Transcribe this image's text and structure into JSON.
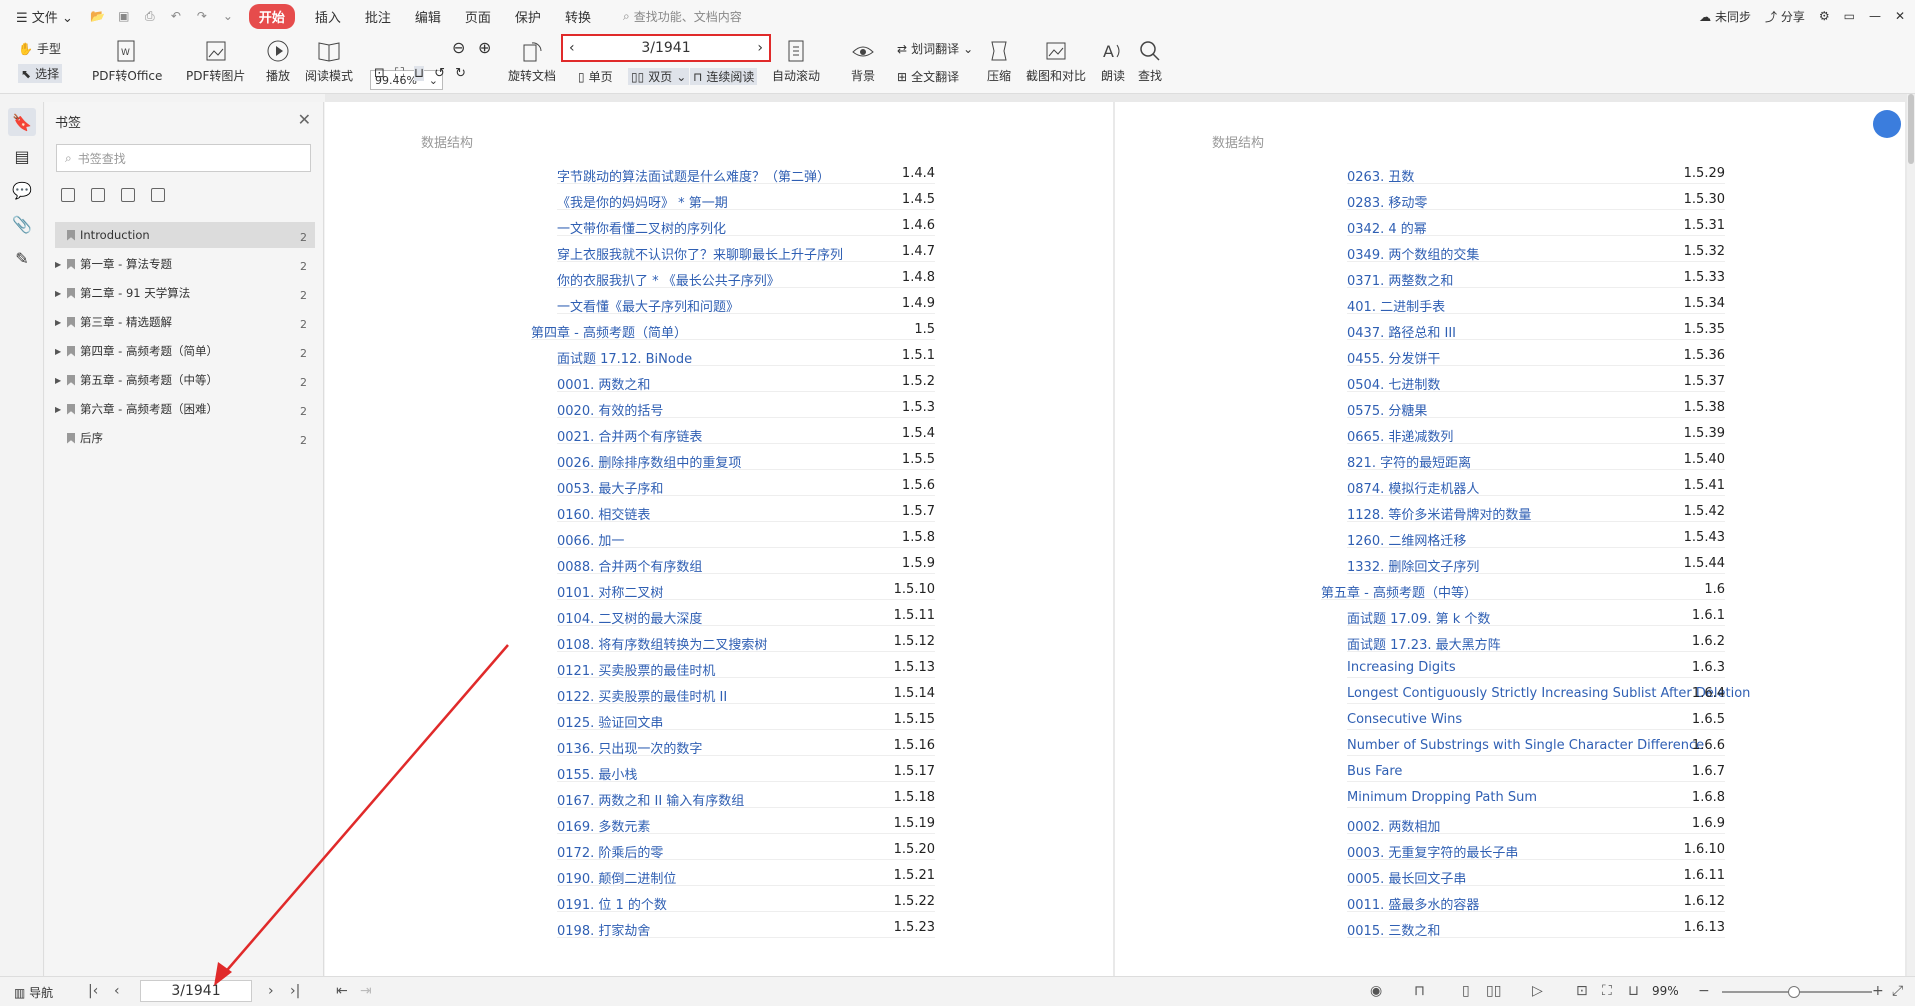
{
  "menubar": {
    "file": "文件",
    "tabs": [
      "开始",
      "插入",
      "批注",
      "编辑",
      "页面",
      "保护",
      "转换"
    ],
    "active_tab": "开始",
    "search_placeholder": "查找功能、文档内容",
    "sync": "未同步",
    "share": "分享"
  },
  "toolbar": {
    "hand": "手型",
    "select": "选择",
    "pdf_to_office": "PDF转Office",
    "pdf_to_image": "PDF转图片",
    "play": "播放",
    "read_mode": "阅读模式",
    "zoom": "99.46%",
    "rotate": "旋转文档",
    "single": "单页",
    "double": "双页",
    "continuous": "连续阅读",
    "page_indicator": "3/1941",
    "auto_scroll": "自动滚动",
    "background": "背景",
    "word_translate": "划词翻译",
    "full_translate": "全文翻译",
    "compress": "压缩",
    "screenshot": "截图和对比",
    "read_aloud": "朗读",
    "find": "查找"
  },
  "panel": {
    "title": "书签",
    "search_placeholder": "书签查找",
    "items": [
      {
        "label": "Introduction",
        "count": "2",
        "expandable": false
      },
      {
        "label": "第一章 - 算法专题",
        "count": "2",
        "expandable": true
      },
      {
        "label": "第二章 - 91 天学算法",
        "count": "2",
        "expandable": true
      },
      {
        "label": "第三章 - 精选题解",
        "count": "2",
        "expandable": true
      },
      {
        "label": "第四章 - 高频考题（简单）",
        "count": "2",
        "expandable": true
      },
      {
        "label": "第五章 - 高频考题（中等）",
        "count": "2",
        "expandable": true
      },
      {
        "label": "第六章 - 高频考题（困难）",
        "count": "2",
        "expandable": true
      },
      {
        "label": "后序",
        "count": "2",
        "expandable": false
      }
    ]
  },
  "left_page": {
    "header": "数据结构",
    "rows": [
      {
        "t": "字节跳动的算法面试题是什么难度？（第二弹）",
        "n": "1.4.4",
        "lvl": 2
      },
      {
        "t": "《我是你的妈妈呀》 * 第一期",
        "n": "1.4.5",
        "lvl": 2
      },
      {
        "t": "一文带你看懂二叉树的序列化",
        "n": "1.4.6",
        "lvl": 2
      },
      {
        "t": "穿上衣服我就不认识你了？来聊聊最长上升子序列",
        "n": "1.4.7",
        "lvl": 2
      },
      {
        "t": "你的衣服我扒了 * 《最长公共子序列》",
        "n": "1.4.8",
        "lvl": 2
      },
      {
        "t": "一文看懂《最大子序列和问题》",
        "n": "1.4.9",
        "lvl": 2
      },
      {
        "t": "第四章 - 高频考题（简单）",
        "n": "1.5",
        "lvl": 1
      },
      {
        "t": "面试题 17.12. BiNode",
        "n": "1.5.1",
        "lvl": 2
      },
      {
        "t": "0001. 两数之和",
        "n": "1.5.2",
        "lvl": 2
      },
      {
        "t": "0020. 有效的括号",
        "n": "1.5.3",
        "lvl": 2
      },
      {
        "t": "0021. 合并两个有序链表",
        "n": "1.5.4",
        "lvl": 2
      },
      {
        "t": "0026. 删除排序数组中的重复项",
        "n": "1.5.5",
        "lvl": 2
      },
      {
        "t": "0053. 最大子序和",
        "n": "1.5.6",
        "lvl": 2
      },
      {
        "t": "0160. 相交链表",
        "n": "1.5.7",
        "lvl": 2
      },
      {
        "t": "0066. 加一",
        "n": "1.5.8",
        "lvl": 2
      },
      {
        "t": "0088. 合并两个有序数组",
        "n": "1.5.9",
        "lvl": 2
      },
      {
        "t": "0101. 对称二叉树",
        "n": "1.5.10",
        "lvl": 2
      },
      {
        "t": "0104. 二叉树的最大深度",
        "n": "1.5.11",
        "lvl": 2
      },
      {
        "t": "0108. 将有序数组转换为二叉搜索树",
        "n": "1.5.12",
        "lvl": 2
      },
      {
        "t": "0121. 买卖股票的最佳时机",
        "n": "1.5.13",
        "lvl": 2
      },
      {
        "t": "0122. 买卖股票的最佳时机 II",
        "n": "1.5.14",
        "lvl": 2
      },
      {
        "t": "0125. 验证回文串",
        "n": "1.5.15",
        "lvl": 2
      },
      {
        "t": "0136. 只出现一次的数字",
        "n": "1.5.16",
        "lvl": 2
      },
      {
        "t": "0155. 最小栈",
        "n": "1.5.17",
        "lvl": 2
      },
      {
        "t": "0167. 两数之和 II 输入有序数组",
        "n": "1.5.18",
        "lvl": 2
      },
      {
        "t": "0169. 多数元素",
        "n": "1.5.19",
        "lvl": 2
      },
      {
        "t": "0172. 阶乘后的零",
        "n": "1.5.20",
        "lvl": 2
      },
      {
        "t": "0190. 颠倒二进制位",
        "n": "1.5.21",
        "lvl": 2
      },
      {
        "t": "0191. 位 1 的个数",
        "n": "1.5.22",
        "lvl": 2
      },
      {
        "t": "0198. 打家劫舍",
        "n": "1.5.23",
        "lvl": 2
      }
    ]
  },
  "right_page": {
    "header": "数据结构",
    "rows": [
      {
        "t": "0263. 丑数",
        "n": "1.5.29",
        "lvl": 2
      },
      {
        "t": "0283. 移动零",
        "n": "1.5.30",
        "lvl": 2
      },
      {
        "t": "0342. 4 的幂",
        "n": "1.5.31",
        "lvl": 2
      },
      {
        "t": "0349. 两个数组的交集",
        "n": "1.5.32",
        "lvl": 2
      },
      {
        "t": "0371. 两整数之和",
        "n": "1.5.33",
        "lvl": 2
      },
      {
        "t": "401. 二进制手表",
        "n": "1.5.34",
        "lvl": 2
      },
      {
        "t": "0437. 路径总和 III",
        "n": "1.5.35",
        "lvl": 2
      },
      {
        "t": "0455. 分发饼干",
        "n": "1.5.36",
        "lvl": 2
      },
      {
        "t": "0504. 七进制数",
        "n": "1.5.37",
        "lvl": 2
      },
      {
        "t": "0575. 分糖果",
        "n": "1.5.38",
        "lvl": 2
      },
      {
        "t": "0665. 非递减数列",
        "n": "1.5.39",
        "lvl": 2
      },
      {
        "t": "821. 字符的最短距离",
        "n": "1.5.40",
        "lvl": 2
      },
      {
        "t": "0874. 模拟行走机器人",
        "n": "1.5.41",
        "lvl": 2
      },
      {
        "t": "1128. 等价多米诺骨牌对的数量",
        "n": "1.5.42",
        "lvl": 2
      },
      {
        "t": "1260. 二维网格迁移",
        "n": "1.5.43",
        "lvl": 2
      },
      {
        "t": "1332. 删除回文子序列",
        "n": "1.5.44",
        "lvl": 2
      },
      {
        "t": "第五章 - 高频考题（中等）",
        "n": "1.6",
        "lvl": 1
      },
      {
        "t": "面试题 17.09. 第 k 个数",
        "n": "1.6.1",
        "lvl": 2
      },
      {
        "t": "面试题 17.23. 最大黑方阵",
        "n": "1.6.2",
        "lvl": 2
      },
      {
        "t": "Increasing Digits",
        "n": "1.6.3",
        "lvl": 2
      },
      {
        "t": "Longest Contiguously Strictly Increasing Sublist After Deletion",
        "n": "1.6.4",
        "lvl": 2
      },
      {
        "t": "Consecutive Wins",
        "n": "1.6.5",
        "lvl": 2
      },
      {
        "t": "Number of Substrings with Single Character Difference",
        "n": "1.6.6",
        "lvl": 2
      },
      {
        "t": "Bus Fare",
        "n": "1.6.7",
        "lvl": 2
      },
      {
        "t": "Minimum Dropping Path Sum",
        "n": "1.6.8",
        "lvl": 2
      },
      {
        "t": "0002. 两数相加",
        "n": "1.6.9",
        "lvl": 2
      },
      {
        "t": "0003. 无重复字符的最长子串",
        "n": "1.6.10",
        "lvl": 2
      },
      {
        "t": "0005. 最长回文子串",
        "n": "1.6.11",
        "lvl": 2
      },
      {
        "t": "0011. 盛最多水的容器",
        "n": "1.6.12",
        "lvl": 2
      },
      {
        "t": "0015. 三数之和",
        "n": "1.6.13",
        "lvl": 2
      }
    ]
  },
  "statusbar": {
    "nav": "导航",
    "page": "3/1941",
    "zoom": "99%"
  },
  "colors": {
    "accent": "#e64c4c",
    "link": "#2f5fb3",
    "highlight_box": "#e02a2a",
    "arrow": "#e02a2a"
  }
}
